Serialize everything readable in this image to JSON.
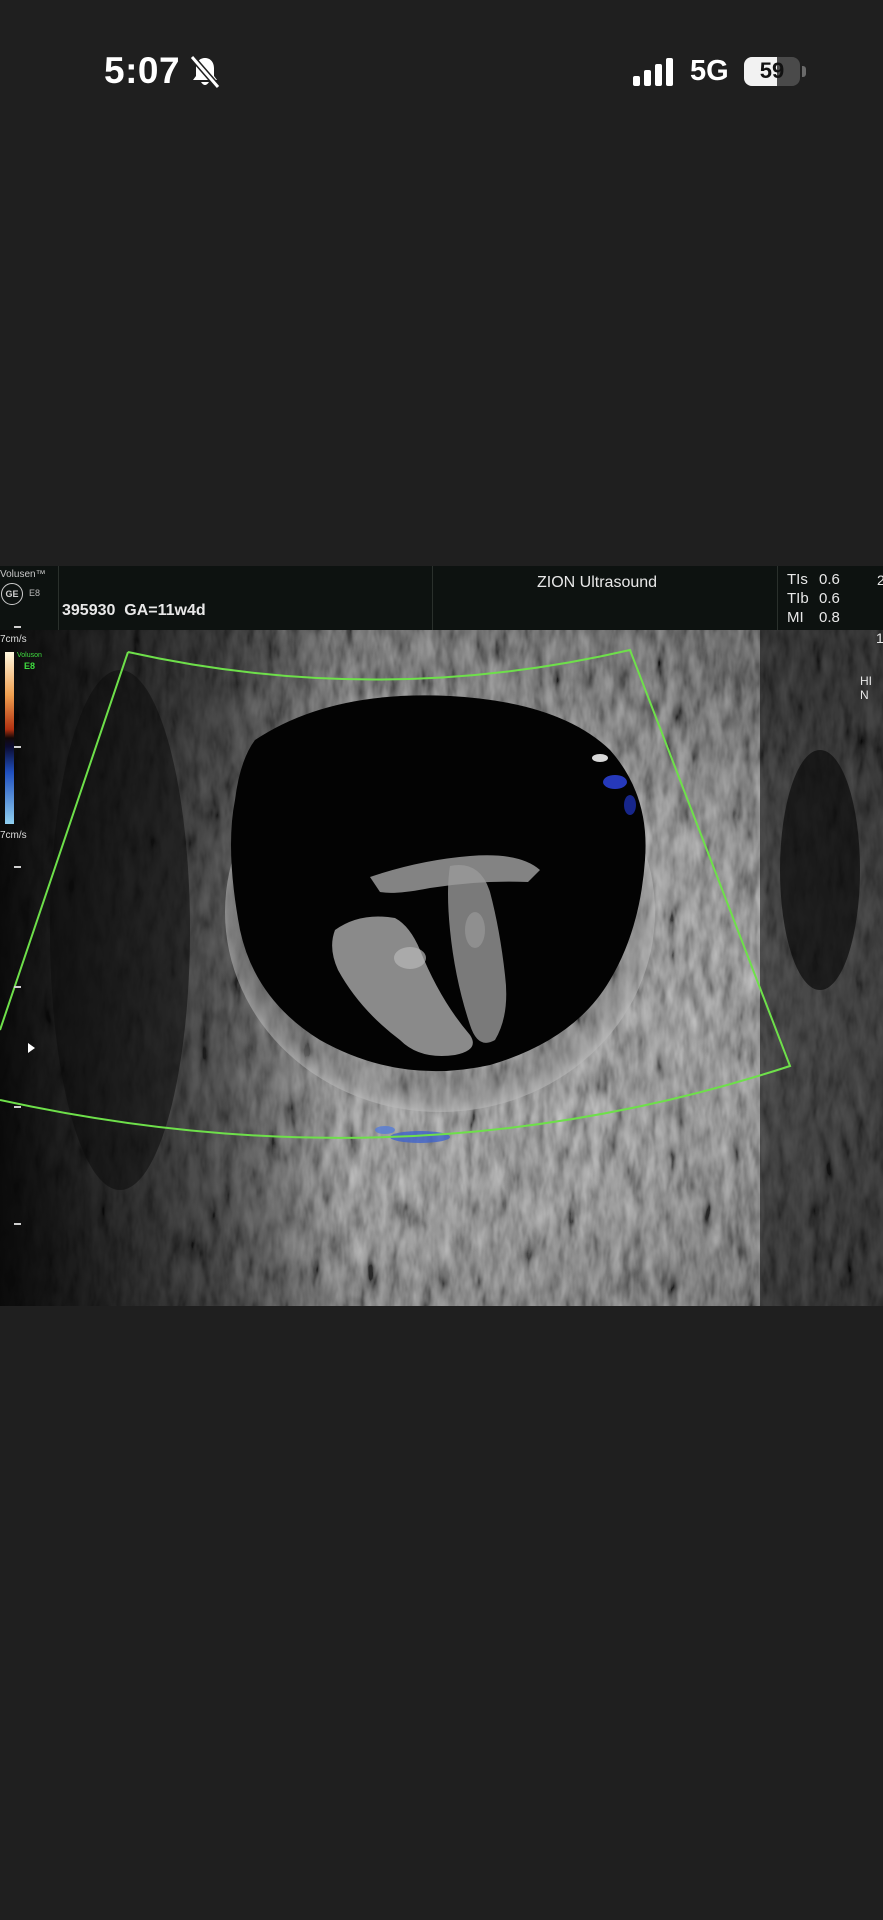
{
  "status_bar": {
    "time": "5:07",
    "network": "5G",
    "battery_percent": "59",
    "battery_level": 0.59,
    "icons": [
      "bell-slash-icon",
      "cellular-signal-icon",
      "battery-icon"
    ]
  },
  "ultrasound": {
    "vendor_label": "Volusen™",
    "logo": "GE",
    "model": "E8",
    "patient_id": "395930",
    "gestational_age": "GA=11w4d",
    "clinic": "ZION Ultrasound",
    "indices": [
      {
        "label": "TIs",
        "value": "0.6"
      },
      {
        "label": "TIb",
        "value": "0.6"
      },
      {
        "label": "MI",
        "value": "0.8"
      }
    ],
    "edge_chars": [
      "2",
      "1",
      "HI N"
    ],
    "color_scale_top": "7cm/s",
    "color_scale_bottom": "7cm/s",
    "preset_name": "Voluson",
    "preset_code": "E8",
    "colors": {
      "roi_outline": "#6ee04a",
      "background": "#1f1f1f",
      "preset_text": "#3fdc3f"
    }
  }
}
